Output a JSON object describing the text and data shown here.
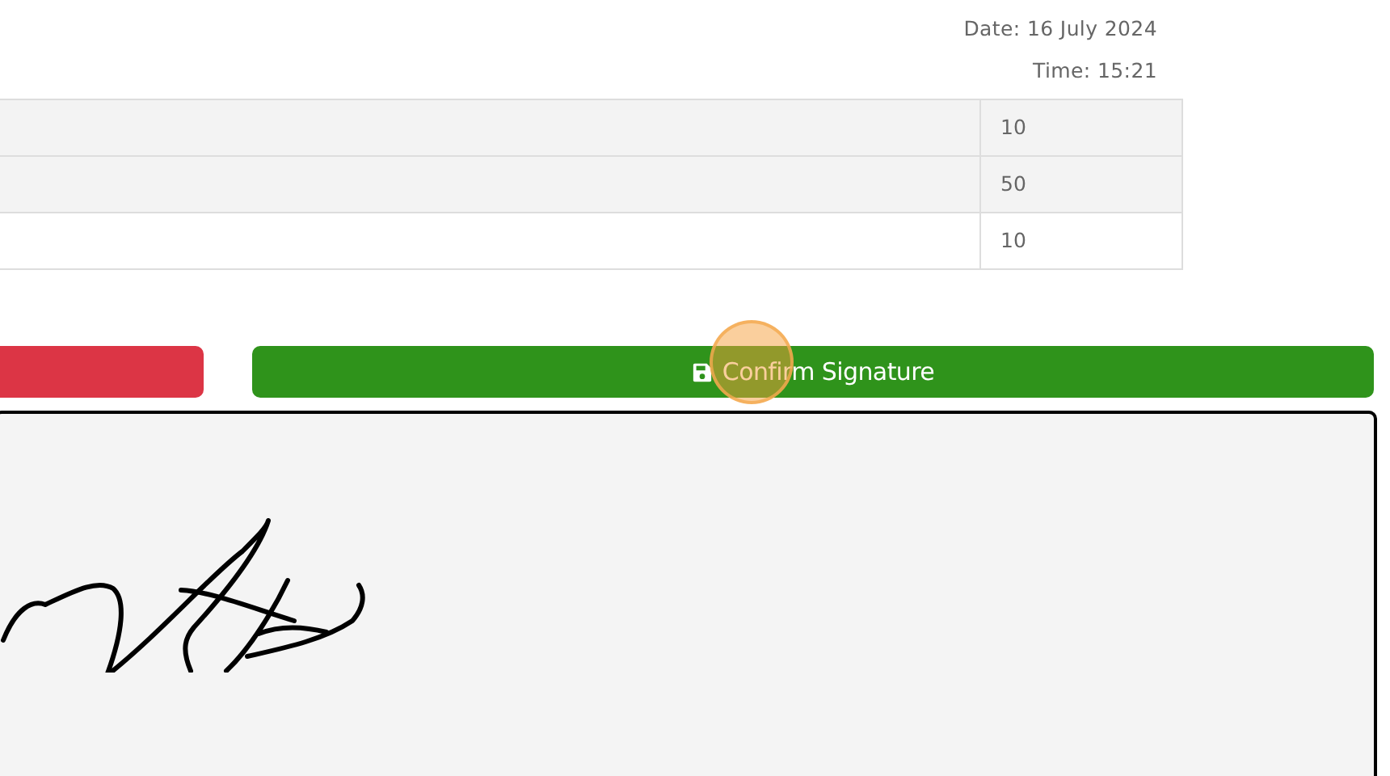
{
  "header": {
    "date": "Date: 16 July 2024",
    "time": "Time: 15:21"
  },
  "table": {
    "rows": [
      {
        "column_2": "10",
        "kind": "shaded"
      },
      {
        "column_2": "50",
        "kind": "shaded"
      },
      {
        "column_2": "10",
        "kind": "plain"
      }
    ]
  },
  "buttons": [
    {
      "kind": "danger"
    },
    {
      "kind": "confirm",
      "label": "Confirm Signature"
    }
  ],
  "signature_pad": {
    "kind": "signed"
  }
}
